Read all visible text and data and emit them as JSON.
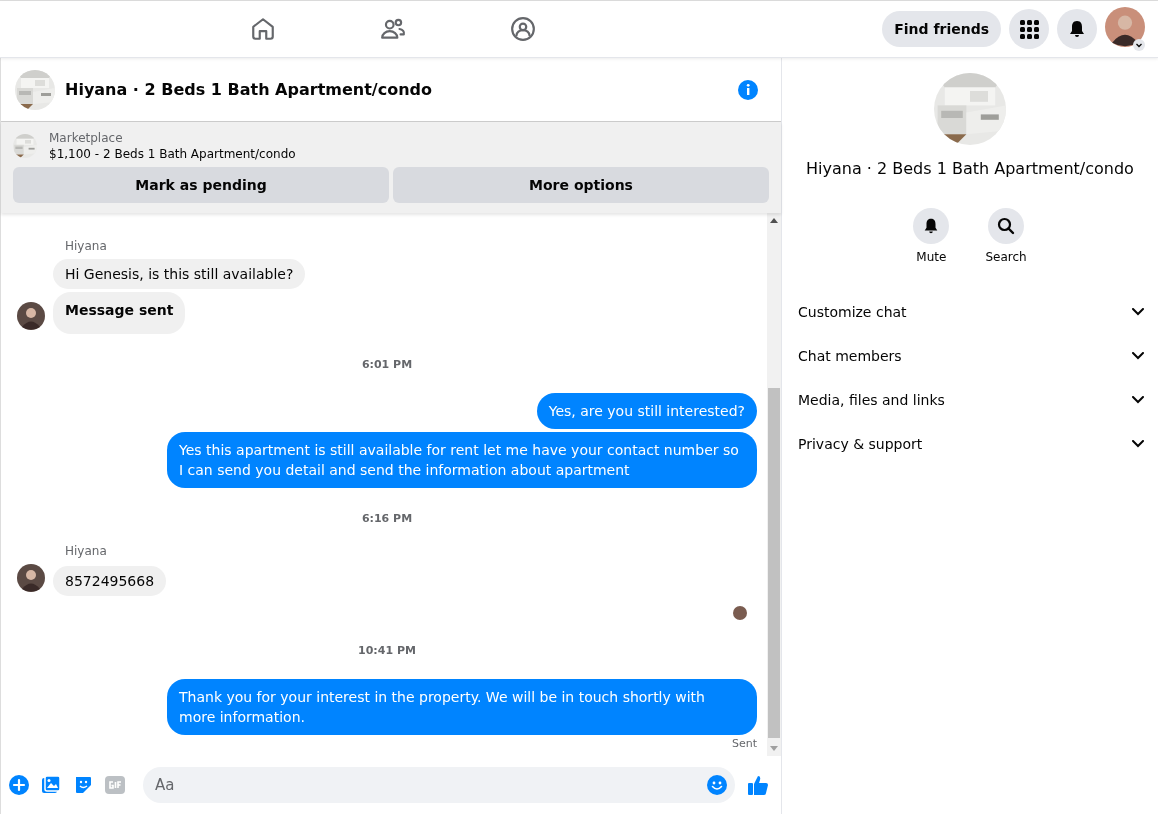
{
  "topbar": {
    "nav": [
      {
        "kind": "home"
      },
      {
        "kind": "friends"
      },
      {
        "kind": "groups"
      }
    ],
    "find_friends": "Find friends"
  },
  "chat": {
    "title": "Hiyana · 2 Beds 1 Bath Apartment/condo",
    "listing": {
      "source": "Marketplace",
      "summary": "$1,100 - 2 Beds 1 Bath Apartment/condo"
    },
    "buttons": [
      "Mark as pending",
      "More options"
    ],
    "messages": [
      {
        "kind": "sender",
        "text": "Hiyana"
      },
      {
        "kind": "incoming",
        "text": "Hi Genesis, is this still available?",
        "avatar": false,
        "bold": false
      },
      {
        "kind": "incoming",
        "text": "Message sent",
        "avatar": true,
        "bold": true
      },
      {
        "kind": "time",
        "text": "6:01 PM"
      },
      {
        "kind": "outgoing",
        "text": "Yes, are you still interested?"
      },
      {
        "kind": "outgoing",
        "text": "Yes this apartment is still available for rent let me have your contact number so I can send you detail and send the information about apartment"
      },
      {
        "kind": "time",
        "text": "6:16 PM"
      },
      {
        "kind": "sender",
        "text": "Hiyana"
      },
      {
        "kind": "incoming",
        "text": "8572495668",
        "avatar": true,
        "bold": false
      },
      {
        "kind": "seen"
      },
      {
        "kind": "time",
        "text": "10:41 PM"
      },
      {
        "kind": "outgoing",
        "text": "Thank you for your interest in the property. We will be in touch shortly with more information."
      },
      {
        "kind": "status",
        "text": "Sent"
      }
    ],
    "composer": {
      "placeholder": "Aa"
    }
  },
  "details": {
    "title": "Hiyana · 2 Beds 1 Bath Apartment/condo",
    "actions": [
      {
        "kind": "bell",
        "label": "Mute"
      },
      {
        "kind": "search",
        "label": "Search"
      }
    ],
    "sections": [
      {
        "label": "Customize chat",
        "expanded": false
      },
      {
        "label": "Chat members",
        "expanded": false
      },
      {
        "label": "Media, files and links",
        "expanded": false
      },
      {
        "label": "Privacy & support",
        "expanded": false
      }
    ]
  }
}
